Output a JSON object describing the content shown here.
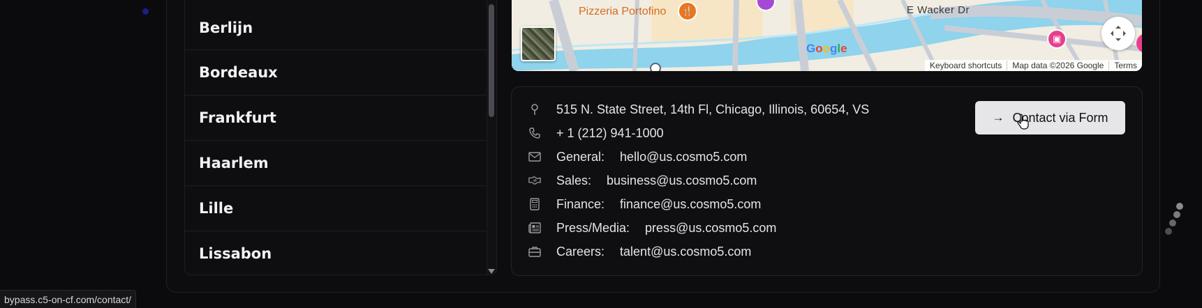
{
  "cities": [
    "Berlijn",
    "Bordeaux",
    "Frankfurt",
    "Haarlem",
    "Lille",
    "Lissabon"
  ],
  "map": {
    "labels": {
      "poi": "Pizzeria Portofino",
      "street": "E Wacker Dr",
      "logo": "Google"
    },
    "footer": {
      "shortcuts": "Keyboard shortcuts",
      "map_data": "Map data ©2026 Google",
      "terms": "Terms"
    }
  },
  "contact": {
    "address": "515 N. State Street, 14th Fl, Chicago, Illinois, 60654, VS",
    "phone": "+ 1 (212) 941-1000",
    "general_label": "General:",
    "general_email": "hello@us.cosmo5.com",
    "sales_label": "Sales:",
    "sales_email": "business@us.cosmo5.com",
    "finance_label": "Finance:",
    "finance_email": "finance@us.cosmo5.com",
    "press_label": "Press/Media:",
    "press_email": "press@us.cosmo5.com",
    "careers_label": "Careers:",
    "careers_email": "talent@us.cosmo5.com",
    "button_label": "Contact via Form"
  },
  "status_url": "bypass.c5-on-cf.com/contact/"
}
